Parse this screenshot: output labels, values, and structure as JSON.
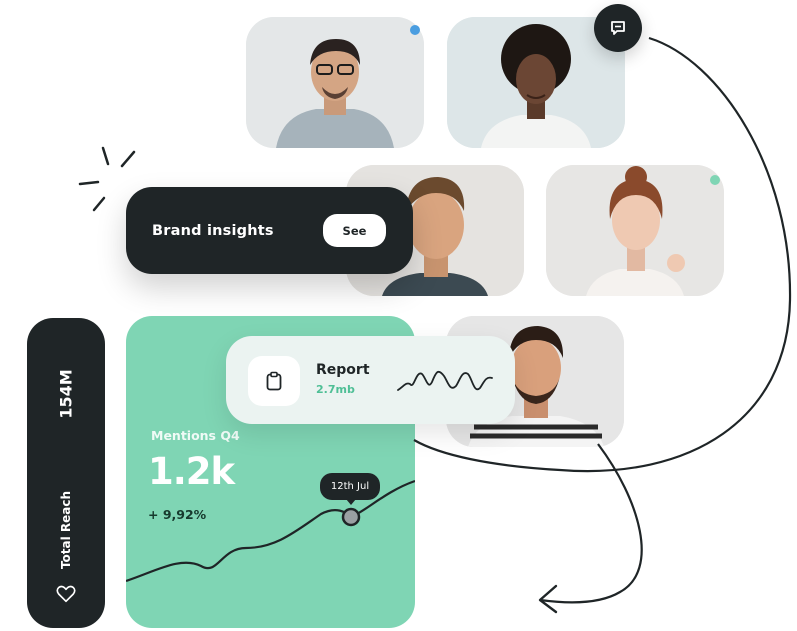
{
  "colors": {
    "dark": "#1f2527",
    "accent_green": "#7fd5b4",
    "status_blue": "#4a9de0",
    "status_green": "#7fd5b4"
  },
  "brand_card": {
    "title": "Brand insights",
    "button_label": "See"
  },
  "reach_card": {
    "value": "154M",
    "label": "Total Reach",
    "icon": "heart-icon"
  },
  "mentions_card": {
    "label": "Mentions Q4",
    "value": "1.2k",
    "change": "+ 9,92%",
    "tooltip_date": "12th Jul"
  },
  "report_card": {
    "title": "Report",
    "size": "2.7mb",
    "icon": "clipboard-icon"
  },
  "chat_button": {
    "icon": "chat-bubble-icon"
  },
  "profiles": [
    {
      "name": "profile-glasses-man",
      "status": "blue"
    },
    {
      "name": "profile-curly-woman",
      "status": "none"
    },
    {
      "name": "profile-man",
      "status": "none"
    },
    {
      "name": "profile-woman-redhair",
      "status": "green"
    },
    {
      "name": "profile-bearded-man",
      "status": "none"
    }
  ]
}
